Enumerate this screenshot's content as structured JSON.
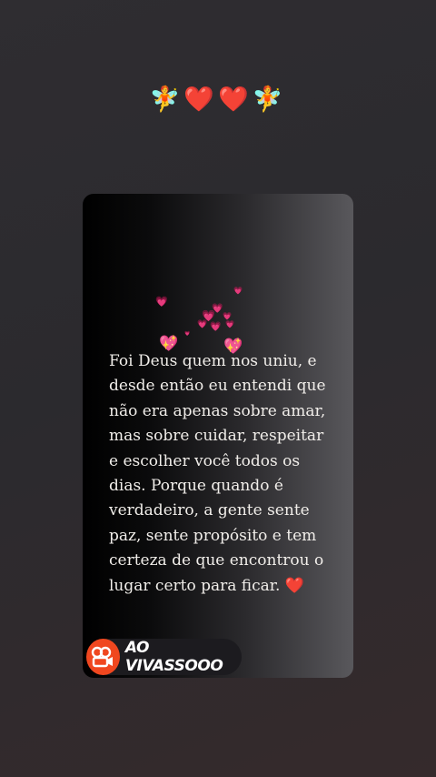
{
  "header": {
    "emoji_row": "🧚❤️❤️🧚"
  },
  "card": {
    "quote": "Foi Deus quem nos uniu, e desde então eu entendi que não era apenas sobre amar, mas sobre cuidar, respeitar e escolher você todos os dias. Porque quando é verdadeiro, a gente sente paz, sente propósito e tem certeza de que encontrou o lugar certo para ficar. ❤️",
    "sparkle_heart": "💖",
    "pink_heart": "💗"
  },
  "live_badge": {
    "label": "AO VIVASSOOO",
    "icon": "kwai-camera-icon",
    "brand_color": "#f0471f"
  }
}
